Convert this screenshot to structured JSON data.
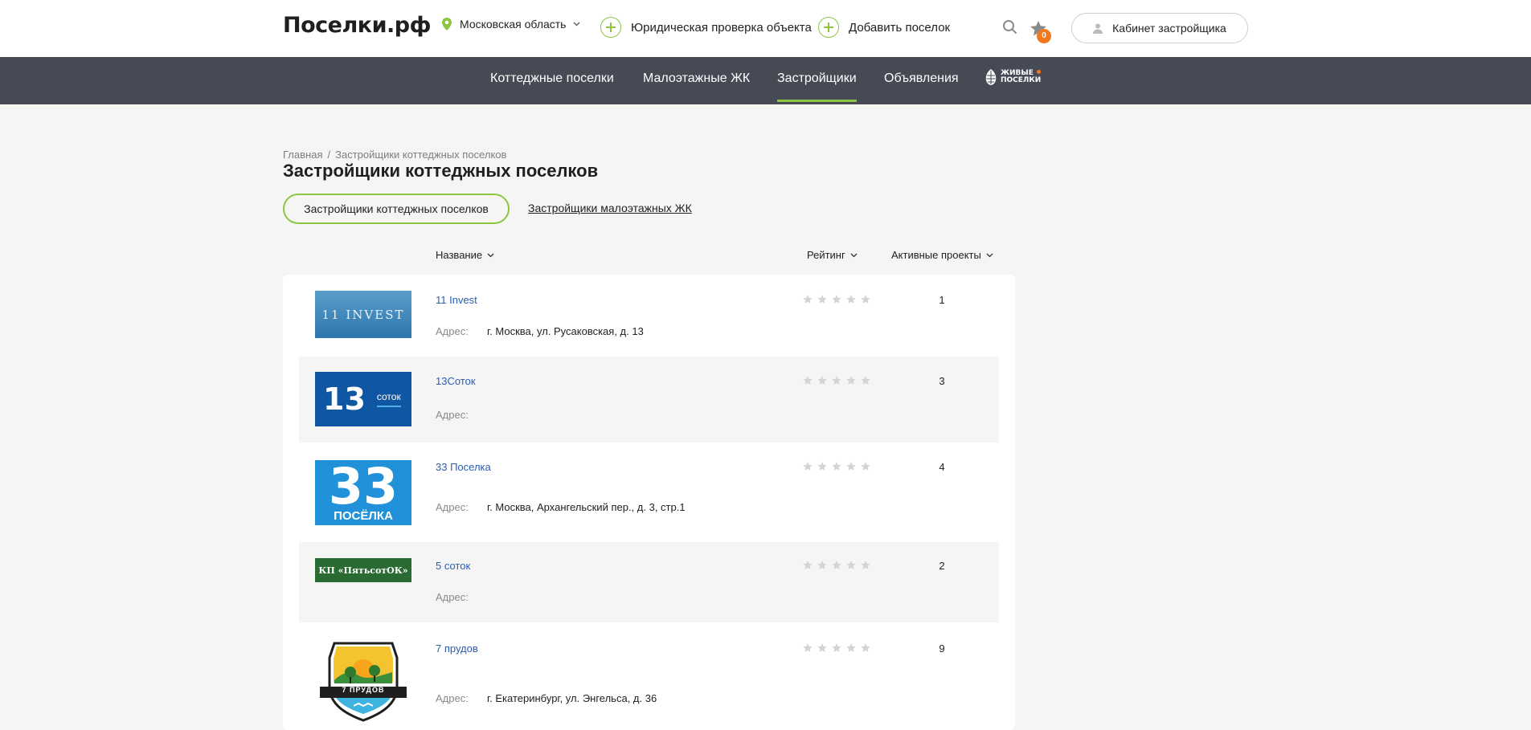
{
  "header": {
    "logo": "Поселки.рф",
    "region": "Московская область",
    "legal_check": "Юридическая проверка объекта",
    "add_village": "Добавить поселок",
    "favorites_count": "0",
    "cabinet": "Кабинет застройщика",
    "icons": [
      "location-pin-icon",
      "chevron-down-icon",
      "plus-circle-icon",
      "search-icon",
      "star-icon",
      "user-icon"
    ]
  },
  "nav": {
    "items": [
      "Коттеджные поселки",
      "Малоэтажные ЖК",
      "Застройщики",
      "Объявления"
    ],
    "active": "Застройщики",
    "partner_logo_line1": "Живые",
    "partner_logo_line2": "поселки"
  },
  "breadcrumb": {
    "home": "Главная",
    "separator": "/",
    "current": "Застройщики коттеджных поселков"
  },
  "page": {
    "title": "Застройщики коттеджных поселков",
    "tab_active": "Застройщики коттеджных поселков",
    "tab_other": "Застройщики малоэтажных ЖК"
  },
  "columns": {
    "name": "Название",
    "rating": "Рейтинг",
    "projects": "Активные проекты"
  },
  "address_label": "Адрес:",
  "developers": [
    {
      "name": "11 Invest",
      "address": "г. Москва, ул. Русаковская, д. 13",
      "rating": 0,
      "projects": "1",
      "logo_text": "11 INVEST"
    },
    {
      "name": "13Соток",
      "address": "",
      "rating": 0,
      "projects": "3",
      "logo_big": "13",
      "logo_small": "соток"
    },
    {
      "name": "33 Поселка",
      "address": "г. Москва, Архангельский пер., д. 3, стр.1",
      "rating": 0,
      "projects": "4",
      "logo_big": "33",
      "logo_small": "ПОСЁЛКА"
    },
    {
      "name": "5 соток",
      "address": "",
      "rating": 0,
      "projects": "2",
      "logo_text": "КП «ПятьсотОК»"
    },
    {
      "name": "7 прудов",
      "address": "г. Екатеринбург, ул. Энгельса, д. 36",
      "rating": 0,
      "projects": "9",
      "logo_text": "7 ПРУДОВ"
    }
  ],
  "colors": {
    "accent": "#8cc63f",
    "nav_bg": "#464a54",
    "link": "#2a5db0",
    "badge": "#f07820"
  }
}
